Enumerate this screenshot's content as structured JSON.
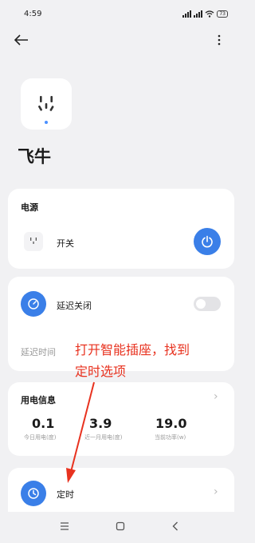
{
  "status": {
    "time": "4:59",
    "battery": "73"
  },
  "device": {
    "name": "飞牛"
  },
  "power_card": {
    "title": "电源",
    "switch_label": "开关"
  },
  "delay_card": {
    "label": "延迟关闭",
    "delay_time_label": "延迟时间",
    "toggle_on": false
  },
  "usage_card": {
    "title": "用电信息",
    "stats": [
      {
        "value": "0.1",
        "label": "今日用电(度)"
      },
      {
        "value": "3.9",
        "label": "近一月用电(度)"
      },
      {
        "value": "19.0",
        "label": "当前功率(w)"
      }
    ]
  },
  "timer_card": {
    "label": "定时"
  },
  "annotation": {
    "line1": "打开智能插座，找到",
    "line2": "定时选项"
  },
  "colors": {
    "accent": "#3a7fe8",
    "annotation": "#e8321f"
  }
}
